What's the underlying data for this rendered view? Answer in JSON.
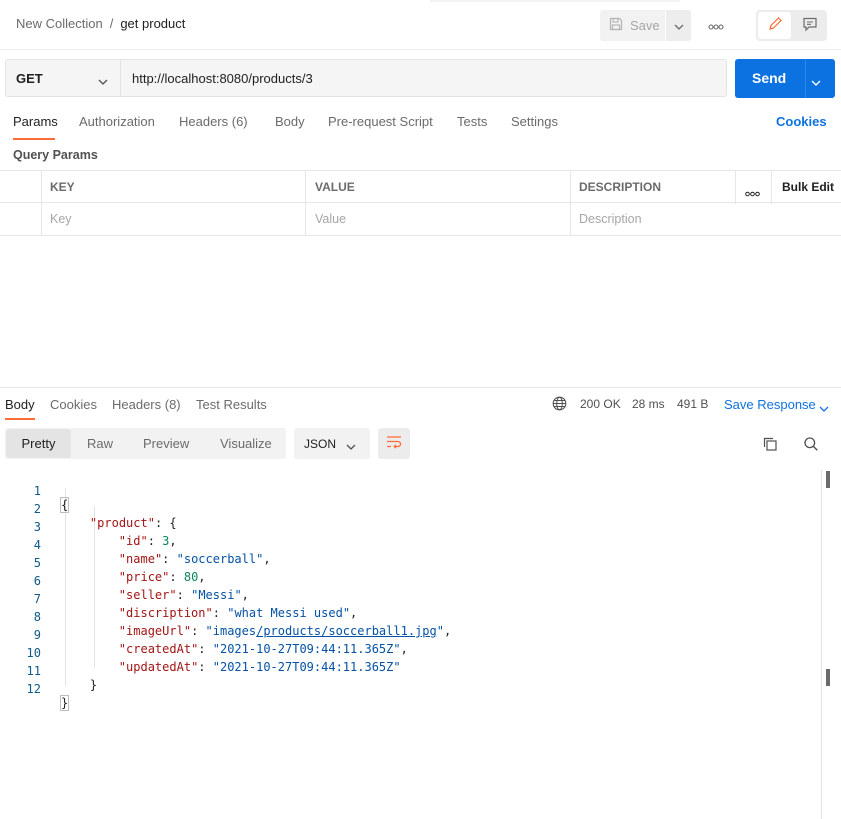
{
  "breadcrumb": {
    "collection": "New Collection",
    "separator": "/",
    "request": "get product"
  },
  "header": {
    "save_label": "Save"
  },
  "request": {
    "method": "GET",
    "url": "http://localhost:8080/products/3",
    "send_label": "Send"
  },
  "request_tabs": [
    "Params",
    "Authorization",
    "Headers (6)",
    "Body",
    "Pre-request Script",
    "Tests",
    "Settings"
  ],
  "cookies_label": "Cookies",
  "params": {
    "title": "Query Params",
    "columns": [
      "KEY",
      "VALUE",
      "DESCRIPTION"
    ],
    "bulk_edit": "Bulk Edit",
    "placeholders": {
      "key": "Key",
      "value": "Value",
      "description": "Description"
    }
  },
  "response": {
    "tabs": [
      "Body",
      "Cookies",
      "Headers (8)",
      "Test Results"
    ],
    "status": "200 OK",
    "time": "28 ms",
    "size": "491 B",
    "save_response": "Save Response",
    "views": [
      "Pretty",
      "Raw",
      "Preview",
      "Visualize"
    ],
    "format": "JSON",
    "line_numbers": [
      "1",
      "2",
      "3",
      "4",
      "5",
      "6",
      "7",
      "8",
      "9",
      "10",
      "11",
      "12"
    ],
    "json": {
      "root_key": "product",
      "fields": [
        {
          "key": "id",
          "value": "3",
          "kind": "num"
        },
        {
          "key": "name",
          "value": "soccerball",
          "kind": "str"
        },
        {
          "key": "price",
          "value": "80",
          "kind": "num"
        },
        {
          "key": "seller",
          "value": "Messi",
          "kind": "str"
        },
        {
          "key": "discription",
          "value": "what Messi used",
          "kind": "str"
        },
        {
          "key": "imageUrl",
          "value_prefix": "images",
          "value_link": "/products/soccerball1.jpg",
          "kind": "link"
        },
        {
          "key": "createdAt",
          "value": "2021-10-27T09:44:11.365Z",
          "kind": "str"
        },
        {
          "key": "updatedAt",
          "value": "2021-10-27T09:44:11.365Z",
          "kind": "str"
        }
      ]
    }
  },
  "icons": {
    "save": "save-icon",
    "caret": "chevron-down-icon",
    "more": "more-horizontal-icon",
    "edit": "pencil-icon",
    "comment": "comment-icon",
    "globe": "globe-icon",
    "wrap": "wrap-lines-icon",
    "copy": "copy-icon",
    "search": "search-icon"
  },
  "colors": {
    "accent": "#0d72e1",
    "tab_indicator": "#ff6c37",
    "json_key": "#a31515",
    "json_string": "#0451a5",
    "json_number": "#098658"
  }
}
